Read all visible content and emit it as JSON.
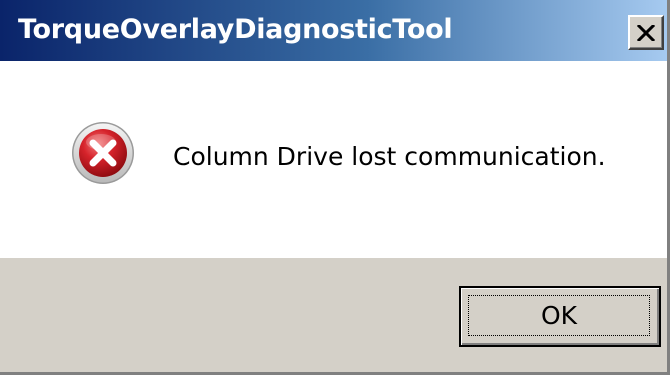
{
  "window": {
    "title": "TorqueOverlayDiagnosticTool",
    "close_icon": "close-icon"
  },
  "dialog": {
    "icon": "error-icon",
    "message": "Column Drive lost communication.",
    "ok_label": "OK"
  },
  "colors": {
    "titlebar_start": "#0a246a",
    "titlebar_end": "#a6caf0",
    "button_face": "#d4d0c8",
    "error_red": "#d6232b"
  }
}
